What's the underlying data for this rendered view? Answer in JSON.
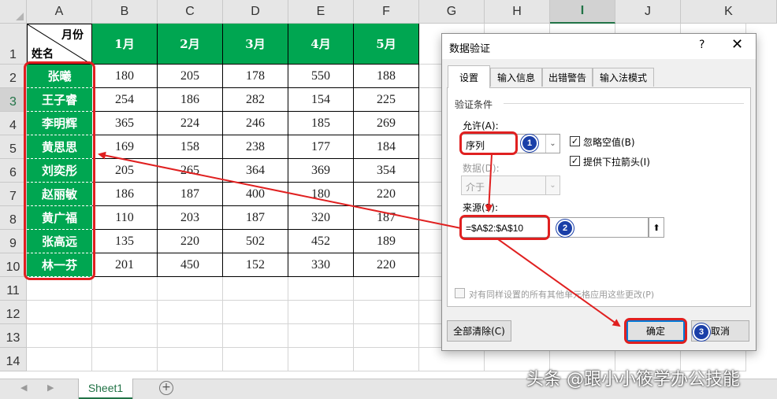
{
  "columns": [
    "A",
    "B",
    "C",
    "D",
    "E",
    "F",
    "G",
    "H",
    "I",
    "J",
    "K"
  ],
  "selected_column": "I",
  "rows": [
    "1",
    "2",
    "3",
    "4",
    "5",
    "6",
    "7",
    "8",
    "9",
    "10",
    "11",
    "12",
    "13",
    "14"
  ],
  "selected_row": "3",
  "table": {
    "header_month_label": "月份",
    "header_name_label": "姓名",
    "months": [
      "1月",
      "2月",
      "3月",
      "4月",
      "5月"
    ],
    "names": [
      "张曦",
      "王子睿",
      "李明辉",
      "黄思思",
      "刘奕彤",
      "赵丽敏",
      "黄广福",
      "张高远",
      "林一芬"
    ],
    "values": [
      [
        "180",
        "205",
        "178",
        "550",
        "188"
      ],
      [
        "254",
        "186",
        "282",
        "154",
        "225"
      ],
      [
        "365",
        "224",
        "246",
        "185",
        "269"
      ],
      [
        "169",
        "158",
        "238",
        "177",
        "184"
      ],
      [
        "205",
        "265",
        "364",
        "369",
        "354"
      ],
      [
        "186",
        "187",
        "400",
        "180",
        "220"
      ],
      [
        "110",
        "203",
        "187",
        "320",
        "187"
      ],
      [
        "135",
        "220",
        "502",
        "452",
        "189"
      ],
      [
        "201",
        "450",
        "152",
        "330",
        "220"
      ]
    ]
  },
  "sheet_tabs": [
    "Sheet1"
  ],
  "add_sheet_symbol": "+",
  "nav_prev": "◀",
  "nav_next": "▶",
  "watermark": "头条 @跟小小筱学办公技能",
  "dialog": {
    "title": "数据验证",
    "help": "?",
    "close": "✕",
    "tabs": [
      "设置",
      "输入信息",
      "出错警告",
      "输入法模式"
    ],
    "active_tab": "设置",
    "criteria_label": "验证条件",
    "allow_label": "允许(A):",
    "allow_value": "序列",
    "ignore_blank_label": "忽略空值(B)",
    "ignore_blank_checked": true,
    "in_cell_dropdown_label": "提供下拉箭头(I)",
    "in_cell_dropdown_checked": true,
    "data_label": "数据(D):",
    "data_value": "介于",
    "source_label": "来源(S):",
    "source_value": "=$A$2:$A$10",
    "apply_all_label": "对有同样设置的所有其他单元格应用这些更改(P)",
    "apply_all_checked": false,
    "clear_all_button": "全部清除(C)",
    "ok_button": "确定",
    "cancel_button": "取消",
    "check_mark": "✓",
    "dropdown_glyph": "⌄",
    "collapse_glyph": "⬆"
  },
  "annotations": {
    "step1": "1",
    "step2": "2",
    "step3": "3"
  },
  "colors": {
    "excel_green": "#00a651",
    "annotation_red": "#e02020",
    "badge_blue": "#1a3fa8",
    "focus_blue": "#0078d7"
  }
}
